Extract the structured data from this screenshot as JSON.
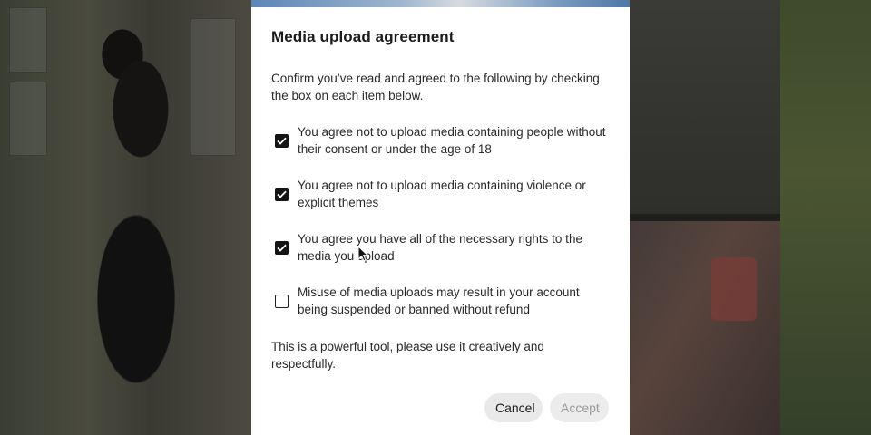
{
  "dialog": {
    "title": "Media upload agreement",
    "intro": "Confirm you’ve read and agreed to the following by checking the box on each item below.",
    "items": [
      {
        "label": "You agree not to upload media containing people without their consent or under the age of 18",
        "checked": true
      },
      {
        "label": "You agree not to upload media containing violence or explicit themes",
        "checked": true
      },
      {
        "label": "You agree you have all of the necessary rights to the media you upload",
        "checked": true
      },
      {
        "label": "Misuse of media uploads may result in your account being suspended or banned without refund",
        "checked": false
      }
    ],
    "footer_text": "This is a powerful tool, please use it creatively and respectfully.",
    "cancel_label": "Cancel",
    "accept_label": "Accept",
    "accept_enabled": false
  }
}
